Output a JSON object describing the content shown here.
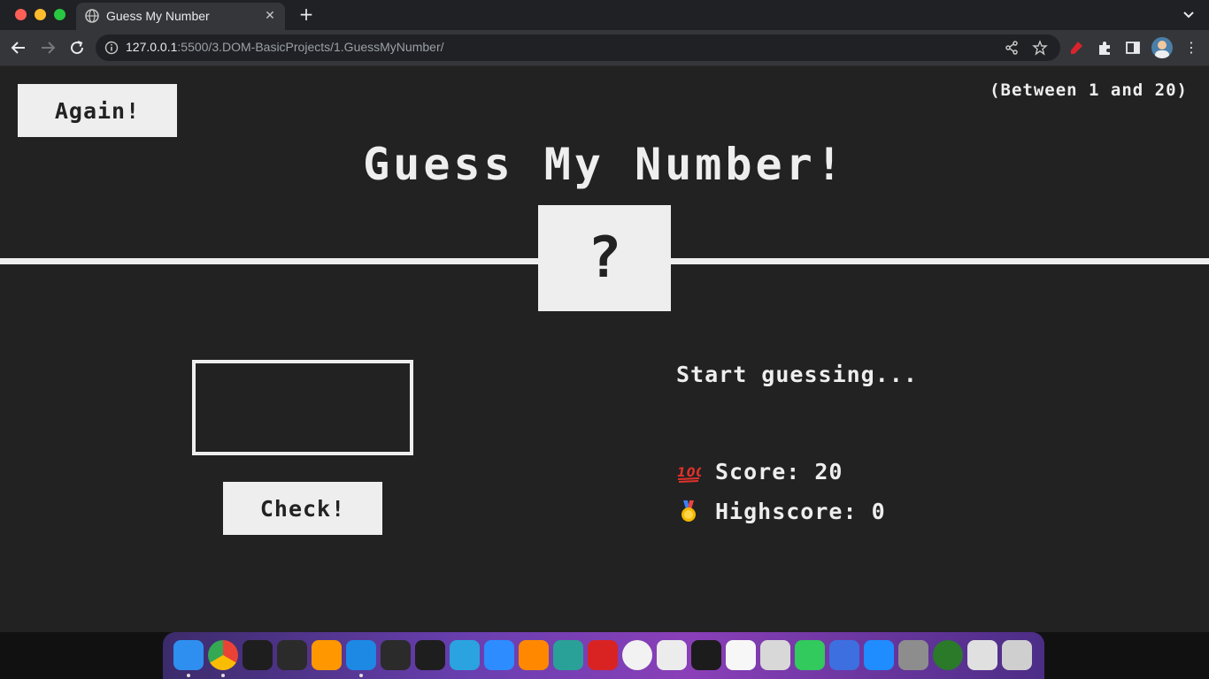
{
  "browser": {
    "tab_title": "Guess My Number",
    "tab_close": "✕",
    "new_tab": "+",
    "url_host": "127.0.0.1",
    "url_path": ":5500/3.DOM-BasicProjects/1.GuessMyNumber/"
  },
  "game": {
    "again_label": "Again!",
    "range_hint": "(Between 1 and 20)",
    "title": "Guess My Number!",
    "secret_display": "?",
    "guess_value": "",
    "check_label": "Check!",
    "message": "Start guessing...",
    "score_label": "Score:",
    "score_value": "20",
    "highscore_label": "Highscore:",
    "highscore_value": "0"
  },
  "dock": {
    "apps": [
      "finder-icon",
      "chrome-icon",
      "terminal-icon",
      "obs-icon",
      "sublime-text-icon",
      "vscode-icon",
      "pycharm-icon",
      "intellij-icon",
      "telegram-icon",
      "zoom-icon",
      "vlc-icon",
      "claquette-icon",
      "acrobat-icon",
      "clock-icon",
      "textedit-icon",
      "activity-monitor-icon",
      "reminders-icon",
      "downloader-icon",
      "puzzle-app-icon",
      "toggles-icon",
      "app-store-icon",
      "system-preferences-icon",
      "green-circle-icon",
      "battery-icon",
      "trash-icon"
    ],
    "colors": [
      "#2f8ff0",
      "#ffffff",
      "#1e1e1e",
      "#2b2b2b",
      "#ff9800",
      "#1e88e5",
      "#2b2b2b",
      "#1e1e1e",
      "#2aa3e0",
      "#2d8cff",
      "#ff8800",
      "#2aa198",
      "#d92323",
      "#f2f2f2",
      "#ececec",
      "#1c1c1c",
      "#f7f7f7",
      "#d8d8d8",
      "#32c95d",
      "#3d6fe0",
      "#1f8cff",
      "#8d8d8d",
      "#2a7a2a",
      "#e0e0e0",
      "#cfcfcf"
    ]
  }
}
